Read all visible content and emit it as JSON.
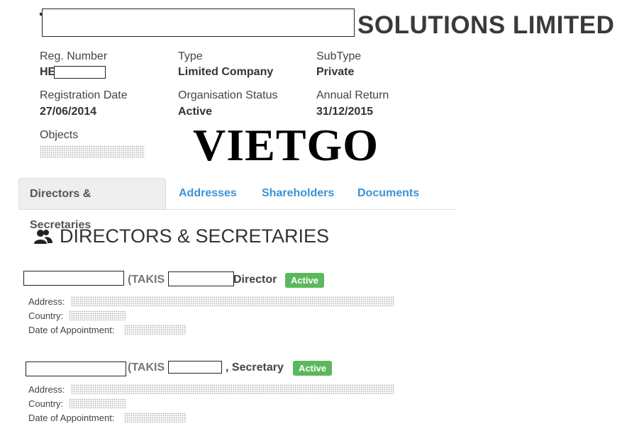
{
  "company": {
    "name_suffix": "SOLUTIONS LIMITED"
  },
  "details": [
    {
      "label": "Reg. Number",
      "value": "HE"
    },
    {
      "label": "Type",
      "value": "Limited Company"
    },
    {
      "label": "SubType",
      "value": "Private"
    },
    {
      "label": "Registration Date",
      "value": "27/06/2014"
    },
    {
      "label": "Organisation Status",
      "value": "Active"
    },
    {
      "label": "Annual Return",
      "value": "31/12/2015"
    },
    {
      "label": "Objects",
      "value": ""
    }
  ],
  "watermark": "VIETGO",
  "tabs": [
    {
      "label": "Directors & Secretaries",
      "active": true
    },
    {
      "label": "Addresses",
      "active": false
    },
    {
      "label": "Shareholders",
      "active": false
    },
    {
      "label": "Documents",
      "active": false
    }
  ],
  "section": {
    "title": "DIRECTORS & SECRETARIES",
    "icon": "users-icon"
  },
  "officers": [
    {
      "paren": "(TAKIS",
      "role": "Director",
      "status": "Active",
      "address_label": "Address:",
      "country_label": "Country:",
      "appointment_label": "Date of Appointment:"
    },
    {
      "paren": "(TAKIS",
      "role": ", Secretary",
      "status": "Active",
      "address_label": "Address:",
      "country_label": "Country:",
      "appointment_label": "Date of Appointment:"
    }
  ],
  "colors": {
    "link": "#3b93d5",
    "badge": "#5cb85c",
    "tab_active_bg": "#eeeeee"
  }
}
